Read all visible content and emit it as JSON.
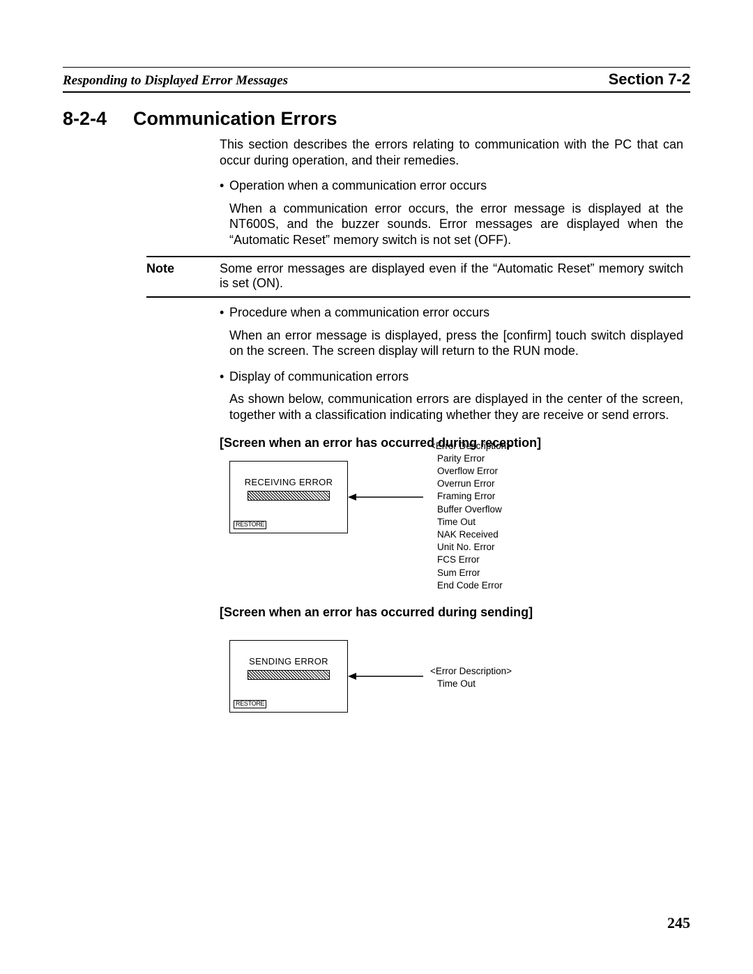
{
  "header": {
    "left": "Responding to Displayed Error Messages",
    "right": "Section 7-2"
  },
  "section": {
    "number": "8-2-4",
    "title": "Communication Errors"
  },
  "intro": "This section describes the errors relating to communication with the PC that can occur during operation, and their remedies.",
  "bullet1": {
    "head": "Operation when a communication error occurs",
    "body": "When a communication error occurs, the error message is displayed at the NT600S, and the buzzer sounds. Error messages are displayed when the “Automatic Reset” memory switch is not set (OFF)."
  },
  "note": {
    "label": "Note",
    "text": "Some error messages are displayed even if the “Automatic Reset” memory switch is set (ON)."
  },
  "bullet2": {
    "head": "Procedure when a communication error occurs",
    "body": "When an error message is displayed, press the [confirm] touch switch displayed on the screen. The screen display will return to the RUN mode."
  },
  "bullet3": {
    "head": "Display of communication errors",
    "body": "As shown below, communication errors are displayed in the center of the screen, together with a classification indicating whether they are receive or send errors."
  },
  "reception": {
    "heading": "[Screen when an error has occurred during reception]",
    "screen_title": "RECEIVING ERROR",
    "restore": "RESTORE",
    "desc_label": "<Error Description>",
    "errors": [
      "Parity Error",
      "Overflow Error",
      "Overrun Error",
      "Framing Error",
      "Buffer Overflow",
      "Time Out",
      "NAK Received",
      "Unit No. Error",
      "FCS Error",
      "Sum Error",
      "End Code Error"
    ]
  },
  "sending": {
    "heading": "[Screen when an error has occurred during sending]",
    "screen_title": "SENDING ERROR",
    "restore": "RESTORE",
    "desc_label": "<Error Description>",
    "errors": [
      "Time Out"
    ]
  },
  "page_number": "245",
  "bullet_glyph": "•"
}
